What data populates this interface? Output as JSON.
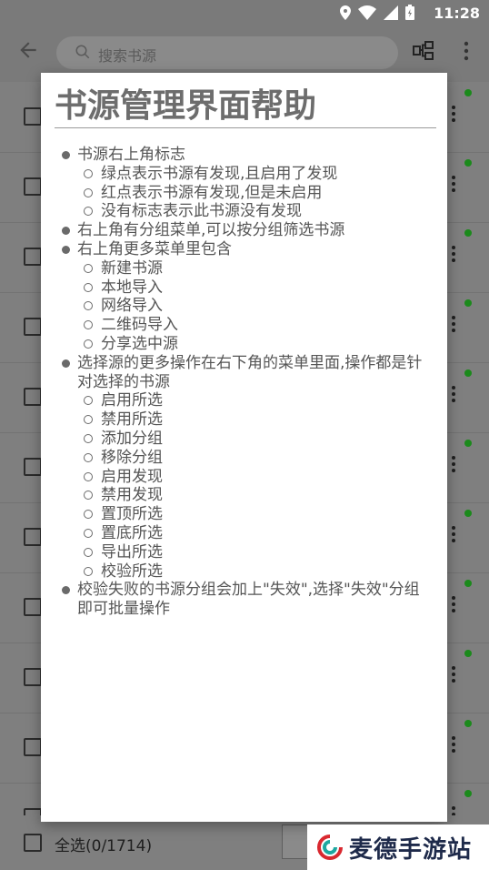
{
  "status_bar": {
    "time": "11:28"
  },
  "toolbar": {
    "search_placeholder": "搜索书源",
    "back_icon": "arrow-left-icon",
    "group_icon": "group-filter-icon",
    "more_icon": "more-vert-icon"
  },
  "list": {
    "enabled_dot_color": "#1b8a1b"
  },
  "bottom_bar": {
    "select_all_label": "全选(0/1714)"
  },
  "dialog": {
    "title": "书源管理界面帮助",
    "items": [
      {
        "text": "书源右上角标志",
        "children": [
          "绿点表示书源有发现,且启用了发现",
          "红点表示书源有发现,但是未启用",
          "没有标志表示此书源没有发现"
        ]
      },
      {
        "text": "右上角有分组菜单,可以按分组筛选书源",
        "children": []
      },
      {
        "text": "右上角更多菜单里包含",
        "children": [
          "新建书源",
          "本地导入",
          "网络导入",
          "二维码导入",
          "分享选中源"
        ]
      },
      {
        "text": "选择源的更多操作在右下角的菜单里面,操作都是针对选择的书源",
        "children": [
          "启用所选",
          "禁用所选",
          "添加分组",
          "移除分组",
          "启用发现",
          "禁用发现",
          "置顶所选",
          "置底所选",
          "导出所选",
          "校验所选"
        ]
      },
      {
        "text": "校验失败的书源分组会加上\"失效\",选择\"失效\"分组即可批量操作",
        "children": []
      }
    ]
  },
  "watermark": {
    "text": "麦德手游站"
  }
}
